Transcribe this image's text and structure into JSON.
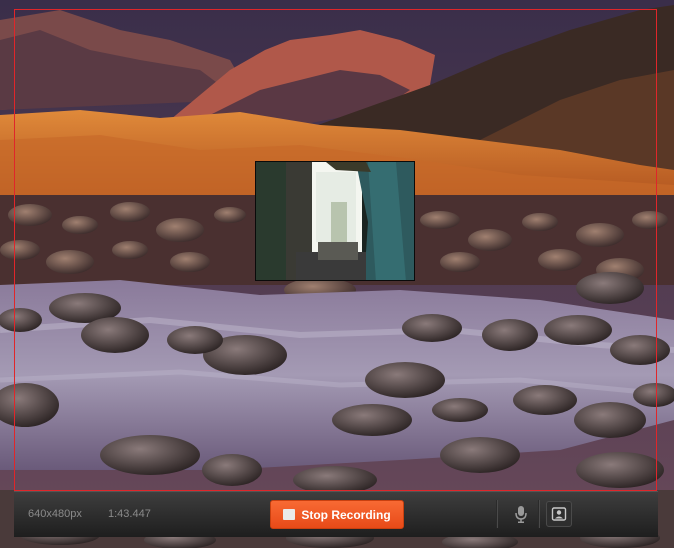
{
  "recorder": {
    "dimensions": "640x480px",
    "elapsed": "1:43.447",
    "stop_label": "Stop Recording"
  },
  "icons": {
    "stop": "stop-square-icon",
    "mic": "microphone-icon",
    "webcam": "webcam-icon"
  },
  "colors": {
    "capture_border": "#e0262a",
    "stop_button": "#f05a24",
    "toolbar": "#2a2a2a"
  }
}
